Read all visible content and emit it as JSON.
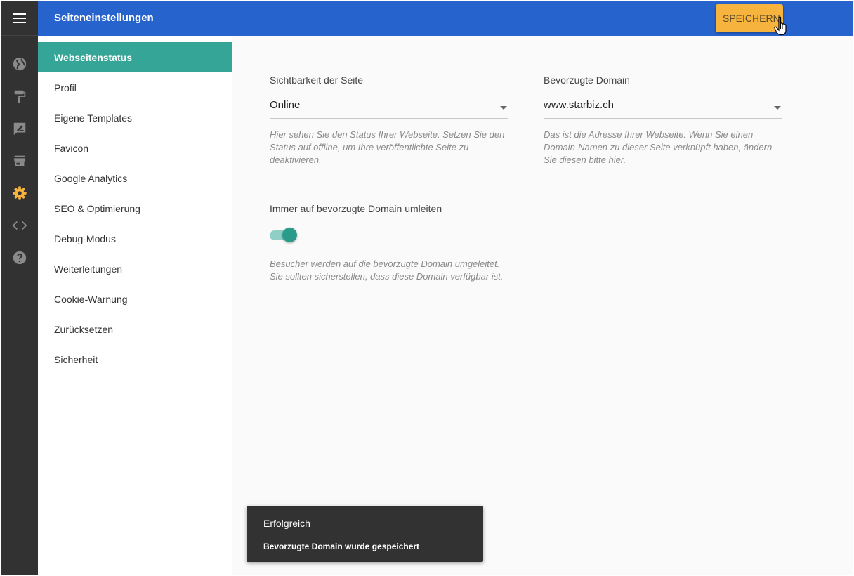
{
  "header": {
    "title": "Seiteneinstellungen",
    "save_label": "SPEICHERN"
  },
  "rail": {
    "icons": [
      "menu-icon",
      "globe-icon",
      "paint-roller-icon",
      "edit-icon",
      "store-icon",
      "gear-icon",
      "code-icon",
      "help-icon"
    ],
    "active": "gear-icon",
    "active_color": "#f6b43f"
  },
  "sidebar": {
    "items": [
      {
        "label": "Webseitenstatus",
        "active": true
      },
      {
        "label": "Profil"
      },
      {
        "label": "Eigene Templates"
      },
      {
        "label": "Favicon"
      },
      {
        "label": "Google Analytics"
      },
      {
        "label": "SEO & Optimierung"
      },
      {
        "label": "Debug-Modus"
      },
      {
        "label": "Weiterleitungen"
      },
      {
        "label": "Cookie-Warnung"
      },
      {
        "label": "Zurücksetzen"
      },
      {
        "label": "Sicherheit"
      }
    ]
  },
  "main": {
    "visibility": {
      "label": "Sichtbarkeit der Seite",
      "value": "Online",
      "hint": "Hier sehen Sie den Status Ihrer Webseite. Setzen Sie den Status auf offline, um Ihre veröffentlichte Seite zu deaktivieren."
    },
    "domain": {
      "label": "Bevorzugte Domain",
      "value": "www.starbiz.ch",
      "hint": "Das ist die Adresse Ihrer Webseite. Wenn Sie einen Domain-Namen zu dieser Seite verknüpft haben, ändern Sie diesen bitte hier."
    },
    "redirect": {
      "label": "Immer auf bevorzugte Domain umleiten",
      "enabled": true,
      "hint": "Besucher werden auf die bevorzugte Domain umgeleitet. Sie sollten sicherstellen, dass diese Domain verfügbar ist."
    }
  },
  "toast": {
    "title": "Erfolgreich",
    "message": "Bevorzugte Domain wurde gespeichert"
  },
  "colors": {
    "header": "#2763cc",
    "rail": "#323232",
    "accent": "#34a596",
    "save_button": "#f6b43f"
  }
}
